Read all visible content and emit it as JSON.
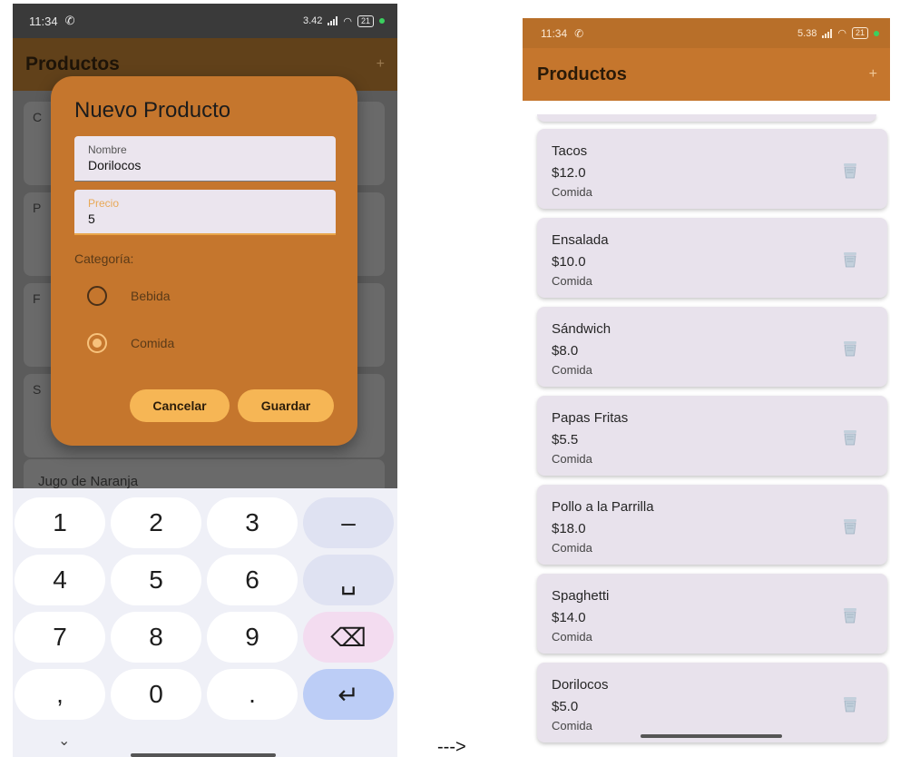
{
  "left_phone": {
    "status": {
      "time": "11:34",
      "speed": "3.42",
      "battery": "21"
    },
    "appbar": {
      "title": "Productos",
      "add": "+"
    },
    "background_cards": [
      {
        "letter": "C"
      },
      {
        "letter": "P"
      },
      {
        "letter": "F"
      },
      {
        "letter": "S"
      }
    ],
    "partial_item": "Jugo de Naranja",
    "dialog": {
      "title": "Nuevo Producto",
      "nombre_label": "Nombre",
      "nombre_value": "Dorilocos",
      "precio_label": "Precio",
      "precio_value": "5",
      "categoria_label": "Categoría:",
      "option_bebida": "Bebida",
      "option_comida": "Comida",
      "selected": "Comida",
      "cancel": "Cancelar",
      "save": "Guardar"
    },
    "keyboard": {
      "rows": [
        [
          "1",
          "2",
          "3",
          "–"
        ],
        [
          "4",
          "5",
          "6",
          "␣"
        ],
        [
          "7",
          "8",
          "9",
          "⌫"
        ],
        [
          ",",
          "0",
          ".",
          "↵"
        ]
      ],
      "chevron": "⌄"
    }
  },
  "arrow": "--->",
  "right_phone": {
    "status": {
      "time": "11:34",
      "speed": "5.38",
      "battery": "21"
    },
    "appbar": {
      "title": "Productos",
      "add": "+"
    },
    "products": [
      {
        "name": "Tacos",
        "price": "$12.0",
        "category": "Comida"
      },
      {
        "name": "Ensalada",
        "price": "$10.0",
        "category": "Comida"
      },
      {
        "name": "Sándwich",
        "price": "$8.0",
        "category": "Comida"
      },
      {
        "name": "Papas Fritas",
        "price": "$5.5",
        "category": "Comida"
      },
      {
        "name": "Pollo a la Parrilla",
        "price": "$18.0",
        "category": "Comida"
      },
      {
        "name": "Spaghetti",
        "price": "$14.0",
        "category": "Comida"
      },
      {
        "name": "Dorilocos",
        "price": "$5.0",
        "category": "Comida"
      }
    ]
  },
  "colors": {
    "accent": "#c5762d",
    "button": "#f6b655",
    "card": "#e8e2ec"
  }
}
